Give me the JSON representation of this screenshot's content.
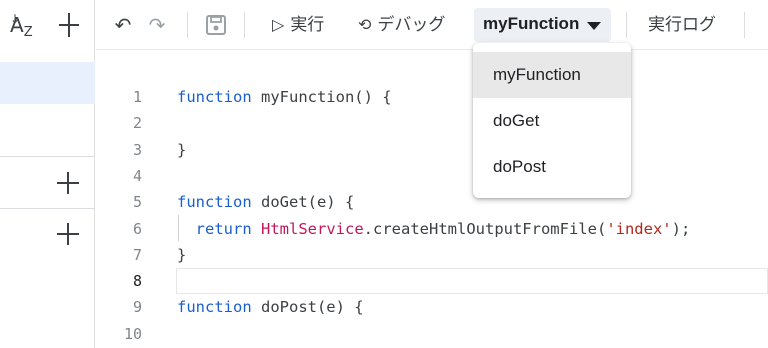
{
  "sidebar": {
    "sort_icon_text": "AZ",
    "sort_icon": "sort-az-icon",
    "add_icon": "plus-icon"
  },
  "toolbar": {
    "undo_icon": "undo-icon",
    "redo_icon": "redo-icon",
    "save_icon": "save-icon",
    "run_label": "実行",
    "debug_label": "デバッグ",
    "function_selected": "myFunction",
    "log_label": "実行ログ"
  },
  "menu": {
    "options": [
      "myFunction",
      "doGet",
      "doPost"
    ],
    "selected": "myFunction"
  },
  "editor": {
    "lines": [
      {
        "no": "1",
        "parts": [
          [
            "kw",
            "function"
          ],
          [
            "t",
            " myFunction() {"
          ]
        ]
      },
      {
        "no": "2",
        "parts": []
      },
      {
        "no": "3",
        "parts": [
          [
            "t",
            "}"
          ]
        ]
      },
      {
        "no": "4",
        "parts": []
      },
      {
        "no": "5",
        "parts": [
          [
            "kw",
            "function"
          ],
          [
            "t",
            " doGet(e) {"
          ]
        ]
      },
      {
        "no": "6",
        "parts": [
          [
            "t",
            "  "
          ],
          [
            "kw",
            "return"
          ],
          [
            "t",
            " "
          ],
          [
            "cls",
            "HtmlService"
          ],
          [
            "t",
            ".createHtmlOutputFromFile("
          ],
          [
            "str",
            "'index'"
          ],
          [
            "t",
            ");"
          ]
        ]
      },
      {
        "no": "7",
        "parts": [
          [
            "t",
            "}"
          ]
        ]
      },
      {
        "no": "8",
        "parts": []
      },
      {
        "no": "9",
        "parts": [
          [
            "kw",
            "function"
          ],
          [
            "t",
            " doPost(e) {"
          ]
        ]
      },
      {
        "no": "10",
        "parts": []
      }
    ],
    "active_line": "8"
  },
  "colors": {
    "keyword": "#1a5fd0",
    "class": "#c2185b",
    "string": "#b3261e",
    "selected_bg": "#e8f0fe"
  }
}
